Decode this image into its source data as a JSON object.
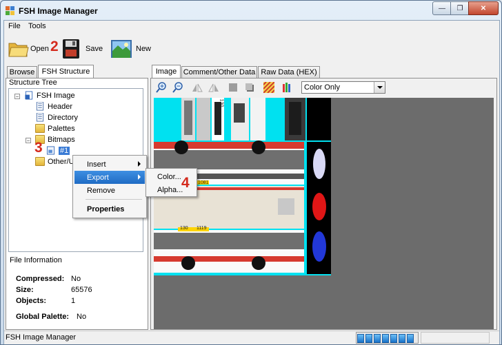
{
  "window": {
    "title": "FSH Image Manager",
    "min_glyph": "—",
    "max_glyph": "❐",
    "close_glyph": "✕"
  },
  "menu": {
    "items": [
      "File",
      "Tools"
    ]
  },
  "toolbar": {
    "open_label": "Open",
    "save_label": "Save",
    "new_label": "New"
  },
  "annotations": {
    "n2": "2",
    "n3": "3",
    "n4": "4"
  },
  "left_tabs": {
    "browse": "Browse",
    "structure": "FSH Structure"
  },
  "structure": {
    "heading": "Structure Tree",
    "root": "FSH Image",
    "header": "Header",
    "directory": "Directory",
    "palettes": "Palettes",
    "bitmaps": "Bitmaps",
    "selected": "#1",
    "other": "Other/U",
    "expand_glyph": "−"
  },
  "context_menu": {
    "insert": "Insert",
    "export": "Export",
    "remove": "Remove",
    "properties": "Properties"
  },
  "submenu": {
    "color": "Color...",
    "alpha": "Alpha..."
  },
  "file_info": {
    "heading": "File Information",
    "compressed_label": "Compressed:",
    "compressed_value": "No",
    "size_label": "Size:",
    "size_value": "65576",
    "objects_label": "Objects:",
    "objects_value": "1",
    "palette_label": "Global Palette:",
    "palette_value": "No"
  },
  "right_tabs": {
    "image": "Image",
    "comment": "Comment/Other Data",
    "raw": "Raw Data (HEX)"
  },
  "image_toolbar": {
    "view_mode": "Color Only"
  },
  "bus_texts": {
    "route1": "130",
    "route2": "1081",
    "route3": "130",
    "plate": "1119"
  },
  "status": {
    "text": "FSH Image Manager",
    "progress_segments": 7
  },
  "colors": {
    "accent": "#1f6bc4",
    "annotation": "#d42a1d",
    "transparent_bg": "#00e1f0"
  }
}
